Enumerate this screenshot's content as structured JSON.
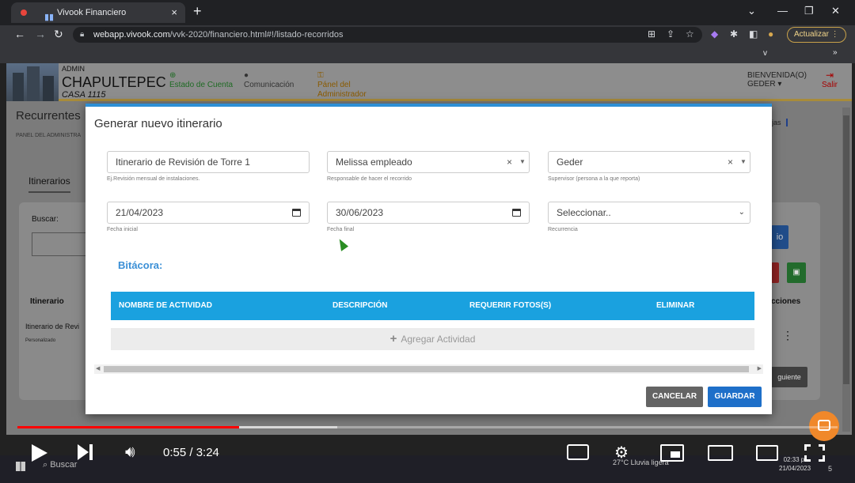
{
  "browser": {
    "tab_title": "Vivook Financiero",
    "tab_close": "×",
    "new_tab": "+",
    "url_host": "webapp.vivook.com",
    "url_path": "/vvk-2020/financiero.html#!/listado-recorridos",
    "update_label": "Actualizar",
    "bookmarks_chevron": "»",
    "bookmarks_v": "v"
  },
  "app": {
    "admin_label": "ADMIN",
    "property_name": "CHAPULTEPEC",
    "house": "CASA 1115",
    "nav": {
      "estado": "Estado de Cuenta",
      "comunicacion": "Comunicación",
      "panel_line1": "Pánel del",
      "panel_line2": "Administrador"
    },
    "welcome_label": "BIENVENIDA(O)",
    "user_name": "GEDER",
    "logout": "Salir",
    "page_title": "Recurrentes",
    "breadcrumb": "PANEL DEL ADMINISTRA",
    "cajas_partial": "ajas",
    "tab_itinerarios": "Itinerarios",
    "search_label": "Buscar:",
    "col_itinerario": "Itinerario",
    "col_acciones": "cciones",
    "row_name": "Itinerario de Revi",
    "row_sub": "Personalizado",
    "blue_btn_partial": "io",
    "next_btn_partial": "guiente"
  },
  "modal": {
    "title": "Generar nuevo itinerario",
    "name_value": "Itinerario de Revisión de Torre 1",
    "name_hint": "Ej.Revisión mensual de instalaciones.",
    "responsible_value": "Melissa empleado",
    "responsible_hint": "Responsable de hacer el recorrido",
    "supervisor_value": "Geder",
    "supervisor_hint": "Supervisor (persona a la que reporta)",
    "start_date": "21/04/2023",
    "start_hint": "Fecha inicial",
    "end_date": "30/06/2023",
    "end_hint": "Fecha final",
    "recurrence_value": "Seleccionar..",
    "recurrence_hint": "Recurrencia",
    "clear_symbol": "×",
    "bitacora": "Bitácora:",
    "table_headers": [
      "NOMBRE DE ACTIVIDAD",
      "DESCRIPCIÓN",
      "REQUERIR FOTOS(S)",
      "ELIMINAR"
    ],
    "add_activity": "Agregar Actividad",
    "cancel": "CANCELAR",
    "save": "GUARDAR"
  },
  "player": {
    "time": "0:55 / 3:24",
    "progress_fraction": 0.27,
    "buffered_fraction": 0.39
  },
  "taskbar": {
    "search": "Buscar",
    "weather": "27°C  Lluvia ligera",
    "clock_time": "02:33 p.",
    "clock_date": "21/04/2023",
    "badge": "5"
  }
}
